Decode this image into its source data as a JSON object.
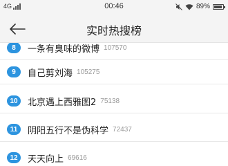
{
  "status_bar": {
    "network": "4G",
    "time": "00:46",
    "battery": "89%",
    "battery_level": 0.89
  },
  "header": {
    "title": "实时热搜榜",
    "back_icon": "back-arrow-icon"
  },
  "list": [
    {
      "rank": "8",
      "topic": "一条有臭味的微博",
      "count": "107570"
    },
    {
      "rank": "9",
      "topic": "自己剪刘海",
      "count": "105275"
    },
    {
      "rank": "10",
      "topic": "北京遇上西雅图2",
      "count": "75138"
    },
    {
      "rank": "11",
      "topic": "阴阳五行不是伪科学",
      "count": "72437"
    },
    {
      "rank": "12",
      "topic": "天天向上",
      "count": "69616"
    }
  ],
  "colors": {
    "rank_badge": "#2d94df",
    "count_text": "#999999",
    "bar_bg": "#f4f4f4"
  }
}
